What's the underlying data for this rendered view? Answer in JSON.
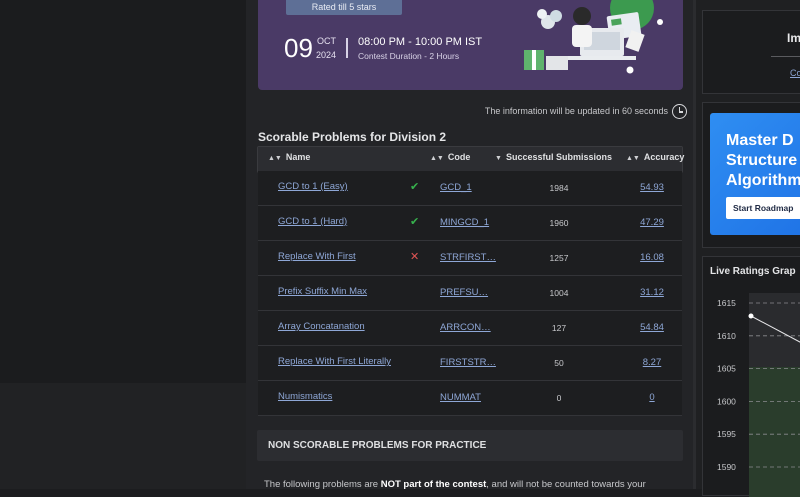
{
  "banner": {
    "rated": "Rated till 5 stars",
    "day": "09",
    "month": "OCT",
    "year": "2024",
    "time": "08:00 PM - 10:00 PM IST",
    "duration": "Contest Duration - 2 Hours"
  },
  "info": "The information will be updated in 60 seconds",
  "section_title": "Scorable Problems for Division 2",
  "table": {
    "headers": {
      "name": "Name",
      "code": "Code",
      "subs": "Successful Submissions",
      "acc": "Accuracy"
    },
    "rows": [
      {
        "name": "GCD to 1 (Easy)",
        "status": "✔",
        "status_kind": "ok",
        "code": "GCD_1",
        "subs": "1984",
        "acc": "54.93"
      },
      {
        "name": "GCD to 1 (Hard)",
        "status": "✔",
        "status_kind": "ok",
        "code": "MINGCD_1",
        "subs": "1960",
        "acc": "47.29"
      },
      {
        "name": "Replace With First",
        "status": "✕",
        "status_kind": "bad",
        "code": "STRFIRST…",
        "subs": "1257",
        "acc": "16.08"
      },
      {
        "name": "Prefix Suffix Min Max",
        "status": "",
        "status_kind": "",
        "code": "PREFSU…",
        "subs": "1004",
        "acc": "31.12"
      },
      {
        "name": "Array Concatanation",
        "status": "",
        "status_kind": "",
        "code": "ARRCON…",
        "subs": "127",
        "acc": "54.84"
      },
      {
        "name": "Replace With First Literally",
        "status": "",
        "status_kind": "",
        "code": "FIRSTSTR…",
        "subs": "50",
        "acc": "8.27"
      },
      {
        "name": "Numismatics",
        "status": "",
        "status_kind": "",
        "code": "NUMMAT",
        "subs": "0",
        "acc": "0"
      }
    ]
  },
  "nonscorable_title": "NON SCORABLE PROBLEMS FOR PRACTICE",
  "footer": {
    "pre": "The following problems are ",
    "bold": "NOT part of the contest",
    "post": ", and will not be counted towards your"
  },
  "right": {
    "card1_title": "Im",
    "card1_link": "Co",
    "ad_heading": "Master D\nStructure\nAlgorithm",
    "ad_button": "Start Roadmap",
    "graph_title": "Live Ratings Grap",
    "graph_ticks": [
      "1615",
      "1610",
      "1605",
      "1600",
      "1595",
      "1590"
    ]
  },
  "colors": {
    "link": "#8ea7d6",
    "ok": "#37b24d",
    "bad": "#e05555",
    "banner": "#4a3a66",
    "ad": "#2f8ef2"
  }
}
